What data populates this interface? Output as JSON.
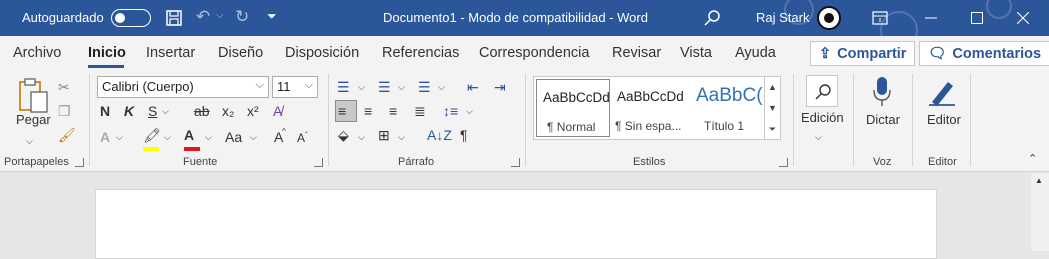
{
  "titlebar": {
    "autosave_label": "Autoguardado",
    "document_title": "Documento1  -  Modo de compatibilidad  -  Word",
    "user_name": "Raj Stark"
  },
  "tabs": [
    {
      "label": "Archivo"
    },
    {
      "label": "Inicio"
    },
    {
      "label": "Insertar"
    },
    {
      "label": "Diseño"
    },
    {
      "label": "Disposición"
    },
    {
      "label": "Referencias"
    },
    {
      "label": "Correspondencia"
    },
    {
      "label": "Revisar"
    },
    {
      "label": "Vista"
    },
    {
      "label": "Ayuda"
    }
  ],
  "share_label": "Compartir",
  "comments_label": "Comentarios",
  "clipboard": {
    "paste_label": "Pegar",
    "group_label": "Portapapeles"
  },
  "font": {
    "name": "Calibri (Cuerpo)",
    "size": "11",
    "group_label": "Fuente",
    "bold": "N",
    "italic": "K",
    "underline": "S",
    "strike": "ab",
    "subscript": "x₂",
    "superscript": "x²",
    "case": "Aa",
    "grow": "A",
    "shrink": "A"
  },
  "paragraph": {
    "group_label": "Párrafo"
  },
  "styles": {
    "group_label": "Estilos",
    "items": [
      {
        "preview": "AaBbCcDd",
        "name": "¶ Normal"
      },
      {
        "preview": "AaBbCcDd",
        "name": "¶ Sin espa..."
      },
      {
        "preview": "AaBbC(",
        "name": "Título 1"
      }
    ]
  },
  "editing": {
    "label": "Edición"
  },
  "voice": {
    "dictate_label": "Dictar",
    "group_label": "Voz"
  },
  "editor": {
    "label": "Editor",
    "group_label": "Editor"
  },
  "colors": {
    "titlebar": "#2b579a",
    "accent": "#2b579a",
    "highlight": "#ffff00",
    "font_color": "#e81123"
  }
}
